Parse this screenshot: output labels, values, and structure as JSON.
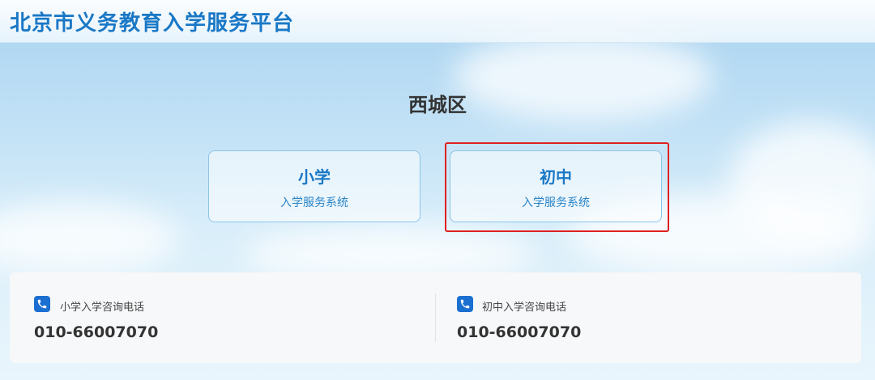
{
  "header": {
    "title": "北京市义务教育入学服务平台"
  },
  "district": "西城区",
  "entries": [
    {
      "title": "小学",
      "subtitle": "入学服务系统"
    },
    {
      "title": "初中",
      "subtitle": "入学服务系统"
    }
  ],
  "contacts": [
    {
      "icon": "phone-icon",
      "label": "小学入学咨询电话",
      "number": "010-66007070"
    },
    {
      "icon": "phone-icon",
      "label": "初中入学咨询电话",
      "number": "010-66007070"
    }
  ],
  "colors": {
    "accent": "#1a78c6",
    "highlight": "#e02020",
    "phone_icon": "#1b6fd1"
  }
}
